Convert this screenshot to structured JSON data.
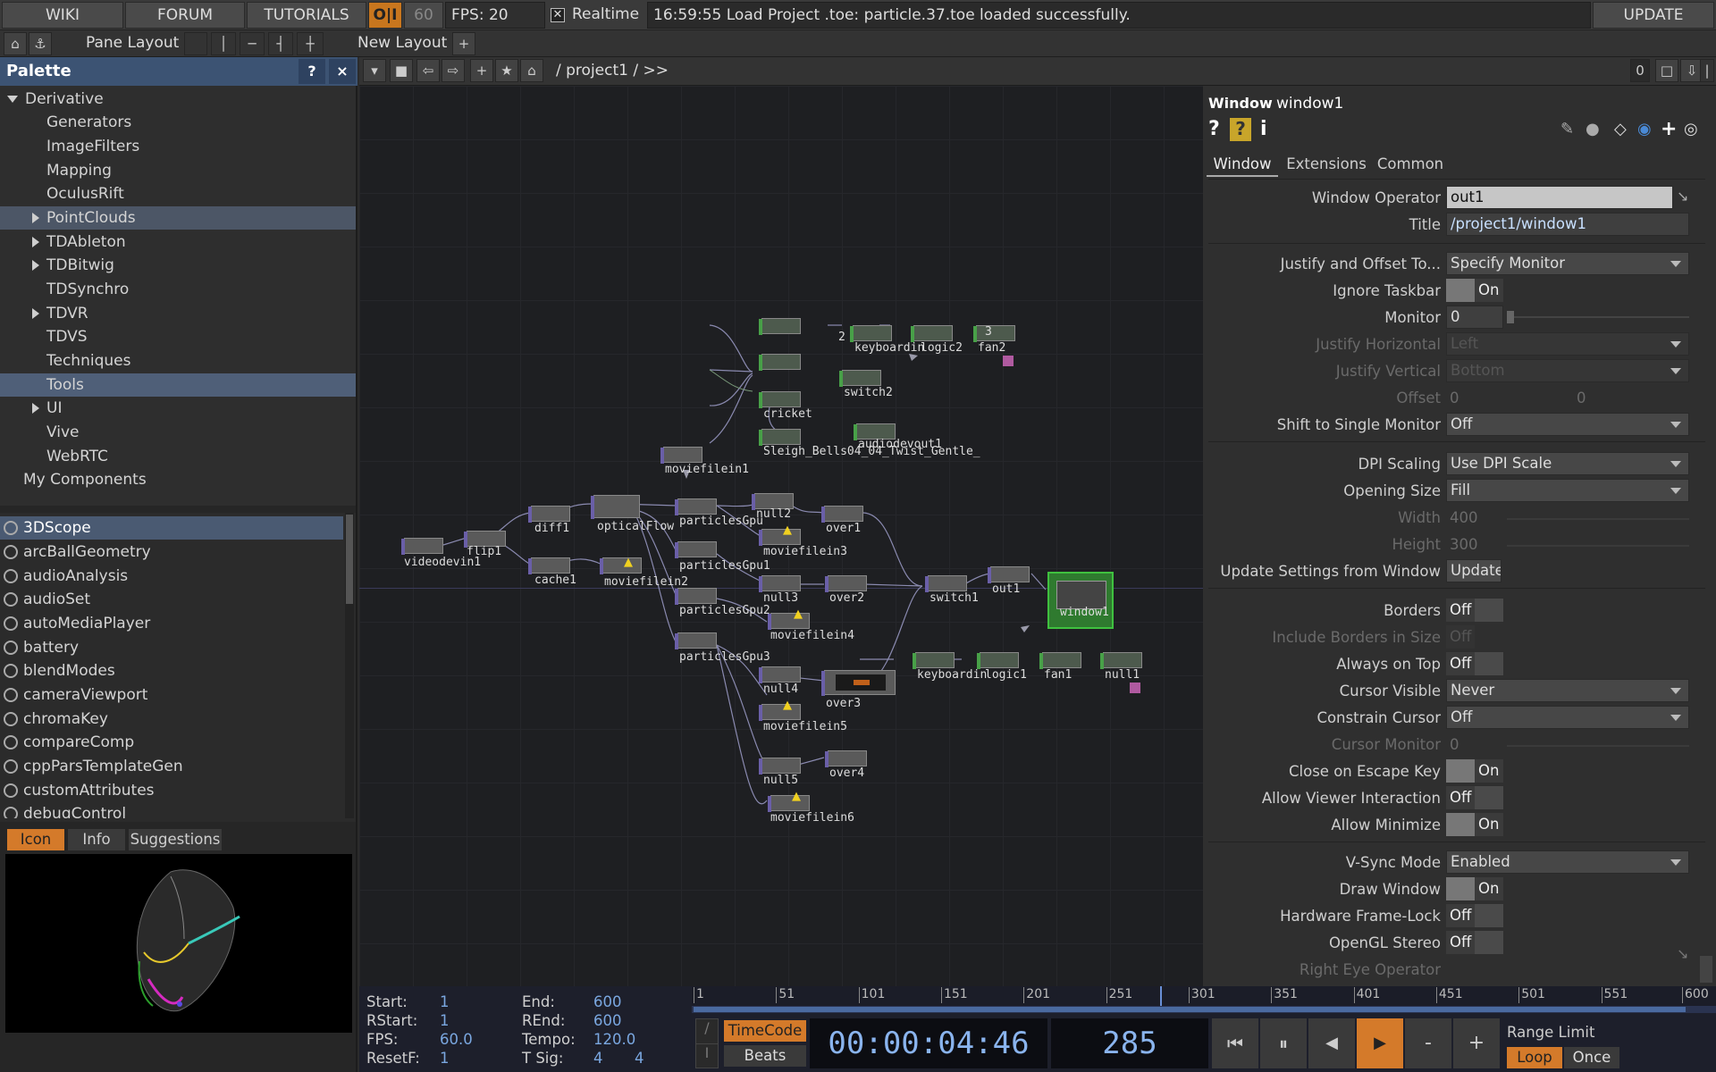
{
  "topbar": {
    "wiki": "WIKI",
    "forum": "FORUM",
    "tutorials": "TUTORIALS",
    "oi": "O|I",
    "fps_cap": "60",
    "fps": "FPS:  20",
    "realtime": "Realtime",
    "status": "16:59:55 Load Project .toe: particle.37.toe loaded successfully.",
    "update": "UPDATE"
  },
  "bar2": {
    "pane_layout": "Pane Layout",
    "new_layout": "New Layout"
  },
  "palette": {
    "title": "Palette",
    "help": "?",
    "close": "×",
    "tree": [
      {
        "label": "Derivative",
        "expanded": true
      },
      {
        "label": "Generators"
      },
      {
        "label": "ImageFilters"
      },
      {
        "label": "Mapping"
      },
      {
        "label": "OculusRift"
      },
      {
        "label": "PointClouds",
        "collapsed": true
      },
      {
        "label": "TDAbleton",
        "collapsed": true
      },
      {
        "label": "TDBitwig",
        "collapsed": true
      },
      {
        "label": "TDSynchro"
      },
      {
        "label": "TDVR",
        "collapsed": true
      },
      {
        "label": "TDVS"
      },
      {
        "label": "Techniques"
      },
      {
        "label": "Tools"
      },
      {
        "label": "UI",
        "collapsed": true
      },
      {
        "label": "Vive"
      },
      {
        "label": "WebRTC"
      },
      {
        "label": "My Components"
      }
    ],
    "components": [
      "3DScope",
      "arcBallGeometry",
      "audioAnalysis",
      "audioSet",
      "autoMediaPlayer",
      "battery",
      "blendModes",
      "cameraViewport",
      "chromaKey",
      "compareComp",
      "cppParsTemplateGen",
      "customAttributes",
      "debugControl"
    ],
    "tabs": [
      "Icon",
      "Info",
      "Suggestions"
    ]
  },
  "network": {
    "path": "/ project1 / >>",
    "counter": "0",
    "nodes": [
      "videodevin1",
      "flip1",
      "diff1",
      "cache1",
      "opticalFlow",
      "moviefilein2",
      "moviefilein1",
      "particlesGpu",
      "particlesGpu1",
      "particlesGpu2",
      "particlesGpu3",
      "null2",
      "moviefilein3",
      "over1",
      "null3",
      "moviefilein4",
      "over2",
      "switch1",
      "out1",
      "window1",
      "null4",
      "over3",
      "moviefilein5",
      "null5",
      "over4",
      "moviefilein6",
      "cricket",
      "Sleigh_Bells04_04_Twist_Gentle_",
      "switch2",
      "audiodevout1",
      "keyboardin",
      "logic2",
      "fan2",
      "keyboardin",
      "logic1",
      "fan1",
      "null1",
      "2",
      "3"
    ]
  },
  "params": {
    "optype": "Window",
    "opname": "window1",
    "tabs": [
      "Window",
      "Extensions",
      "Common"
    ],
    "rows": {
      "window_operator": {
        "label": "Window Operator",
        "value": "out1"
      },
      "title": {
        "label": "Title",
        "value": "/project1/window1"
      },
      "justify_offset": {
        "label": "Justify and Offset To...",
        "value": "Specify Monitor"
      },
      "ignore_taskbar": {
        "label": "Ignore Taskbar",
        "value": "On"
      },
      "monitor": {
        "label": "Monitor",
        "value": "0"
      },
      "justify_h": {
        "label": "Justify Horizontal",
        "value": "Left"
      },
      "justify_v": {
        "label": "Justify Vertical",
        "value": "Bottom"
      },
      "offset": {
        "label": "Offset",
        "v1": "0",
        "v2": "0"
      },
      "shift_single": {
        "label": "Shift to Single Monitor",
        "value": "Off"
      },
      "dpi": {
        "label": "DPI Scaling",
        "value": "Use DPI Scale"
      },
      "opening_size": {
        "label": "Opening Size",
        "value": "Fill"
      },
      "width": {
        "label": "Width",
        "value": "400"
      },
      "height": {
        "label": "Height",
        "value": "300"
      },
      "update_settings": {
        "label": "Update Settings from Window",
        "value": "Update"
      },
      "borders": {
        "label": "Borders",
        "value": "Off"
      },
      "include_borders": {
        "label": "Include Borders in Size",
        "value": "Off"
      },
      "always_top": {
        "label": "Always on Top",
        "value": "Off"
      },
      "cursor_visible": {
        "label": "Cursor Visible",
        "value": "Never"
      },
      "constrain_cursor": {
        "label": "Constrain Cursor",
        "value": "Off"
      },
      "cursor_monitor": {
        "label": "Cursor Monitor",
        "value": "0"
      },
      "close_escape": {
        "label": "Close on Escape Key",
        "value": "On"
      },
      "allow_viewer": {
        "label": "Allow Viewer Interaction",
        "value": "Off"
      },
      "allow_min": {
        "label": "Allow Minimize",
        "value": "On"
      },
      "vsync": {
        "label": "V-Sync Mode",
        "value": "Enabled"
      },
      "draw_window": {
        "label": "Draw Window",
        "value": "On"
      },
      "hw_framelock": {
        "label": "Hardware Frame-Lock",
        "value": "Off"
      },
      "opengl_stereo": {
        "label": "OpenGL Stereo",
        "value": "Off"
      },
      "right_eye": {
        "label": "Right Eye Operator",
        "value": ""
      }
    }
  },
  "timeline": {
    "start_l": "Start:",
    "start": "1",
    "rstart_l": "RStart:",
    "rstart": "1",
    "fps_l": "FPS:",
    "fps": "60.0",
    "resetf_l": "ResetF:",
    "resetf": "1",
    "end_l": "End:",
    "end": "600",
    "rend_l": "REnd:",
    "rend": "600",
    "tempo_l": "Tempo:",
    "tempo": "120.0",
    "tsig_l": "T Sig:",
    "tsig_a": "4",
    "tsig_b": "4",
    "ruler": [
      "1",
      "51",
      "101",
      "151",
      "201",
      "251",
      "301",
      "351",
      "401",
      "451",
      "501",
      "551",
      "600"
    ],
    "timecode_btn": "TimeCode",
    "beats_btn": "Beats",
    "timecode": "00:00:04:46",
    "frame": "285",
    "range_limit": "Range Limit",
    "loop": "Loop",
    "once": "Once",
    "minus": "-",
    "plus": "+",
    "playhead_frame": "285"
  }
}
